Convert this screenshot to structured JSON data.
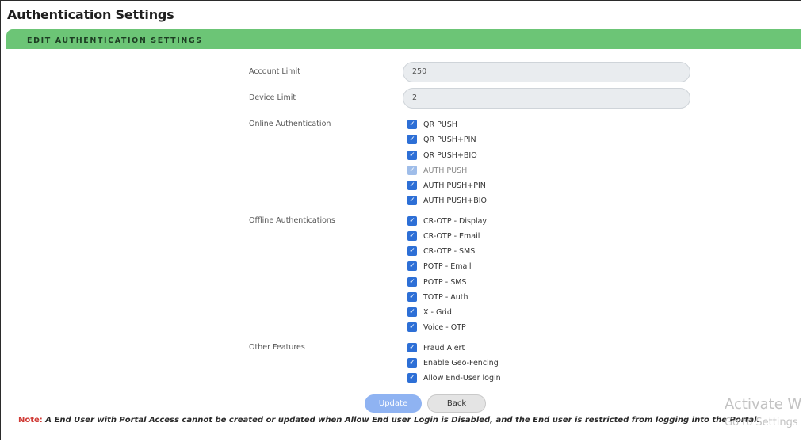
{
  "page": {
    "title": "Authentication Settings"
  },
  "section": {
    "header": "EDIT AUTHENTICATION SETTINGS"
  },
  "form": {
    "account_limit": {
      "label": "Account Limit",
      "value": "250"
    },
    "device_limit": {
      "label": "Device Limit",
      "value": "2"
    },
    "online": {
      "label": "Online Authentication",
      "options": [
        {
          "label": "QR PUSH",
          "checked": true,
          "disabled": false
        },
        {
          "label": "QR PUSH+PIN",
          "checked": true,
          "disabled": false
        },
        {
          "label": "QR PUSH+BIO",
          "checked": true,
          "disabled": false
        },
        {
          "label": "AUTH PUSH",
          "checked": true,
          "disabled": true
        },
        {
          "label": "AUTH PUSH+PIN",
          "checked": true,
          "disabled": false
        },
        {
          "label": "AUTH PUSH+BIO",
          "checked": true,
          "disabled": false
        }
      ]
    },
    "offline": {
      "label": "Offline Authentications",
      "options": [
        {
          "label": "CR-OTP - Display",
          "checked": true
        },
        {
          "label": "CR-OTP - Email",
          "checked": true
        },
        {
          "label": "CR-OTP - SMS",
          "checked": true
        },
        {
          "label": "POTP - Email",
          "checked": true
        },
        {
          "label": "POTP - SMS",
          "checked": true
        },
        {
          "label": "TOTP - Auth",
          "checked": true
        },
        {
          "label": "X - Grid",
          "checked": true
        },
        {
          "label": "Voice - OTP",
          "checked": true
        }
      ]
    },
    "other": {
      "label": "Other Features",
      "options": [
        {
          "label": "Fraud Alert",
          "checked": true
        },
        {
          "label": "Enable Geo-Fencing",
          "checked": true
        },
        {
          "label": "Allow End-User login",
          "checked": true
        }
      ]
    }
  },
  "buttons": {
    "update": "Update",
    "back": "Back"
  },
  "note": {
    "tag": "Note:",
    "text": " A End User with Portal Access cannot be created or updated when Allow End user Login is Disabled, and the End user is restricted from logging into the Portal."
  },
  "watermark": {
    "line1": "Activate W",
    "line2": "Go to Settings"
  },
  "colors": {
    "accent": "#6cc576",
    "checkbox": "#2d6fd6",
    "note_tag": "#d03b36"
  }
}
